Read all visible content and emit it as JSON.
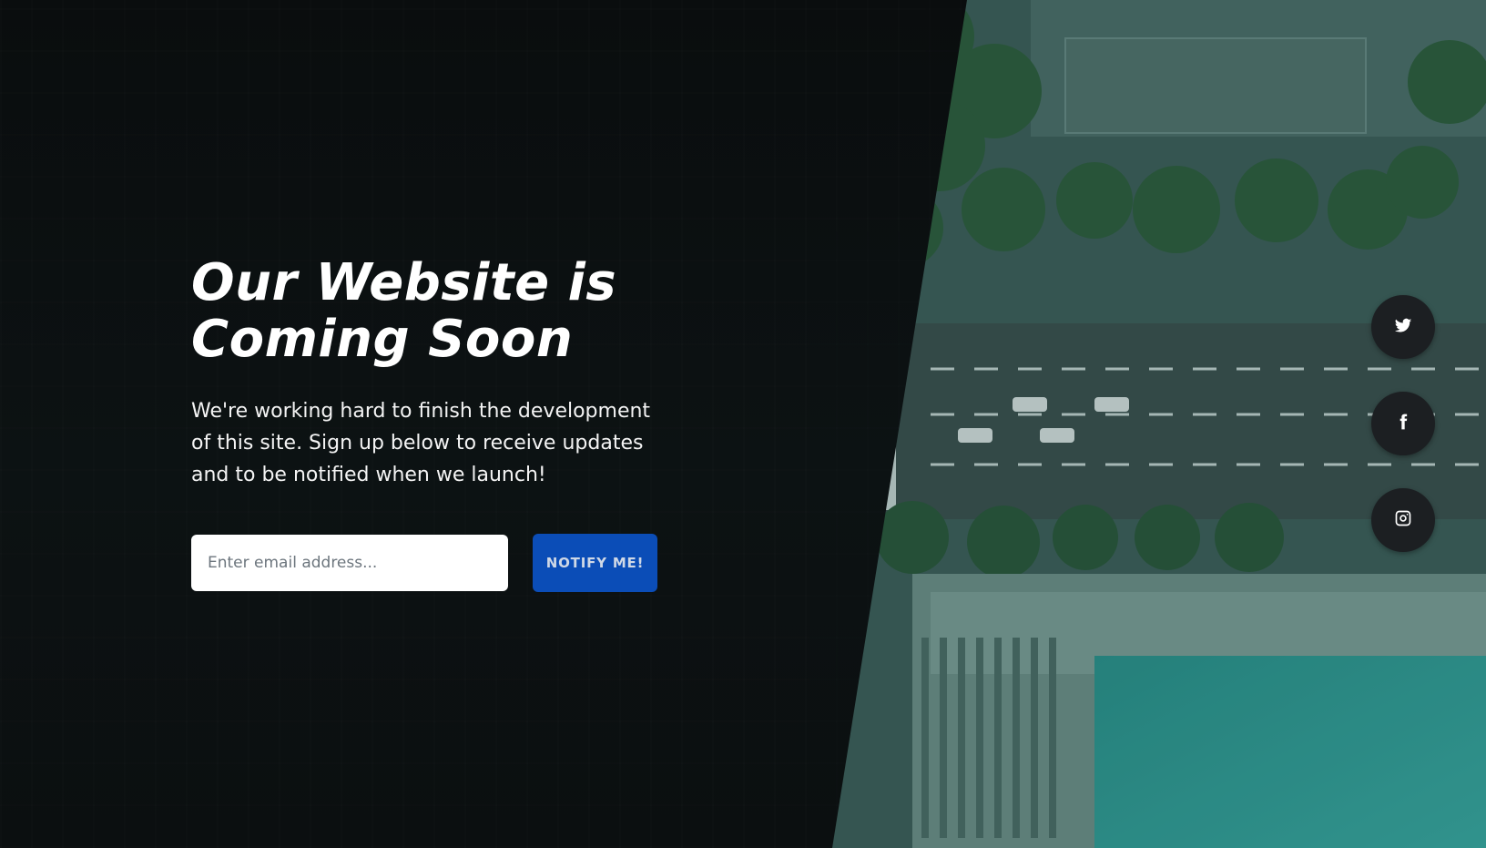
{
  "hero": {
    "title_line1": "Our Website is",
    "title_line2": "Coming Soon",
    "description": "We're working hard to finish the development of this site. Sign up below to receive updates and to be notified when we launch!"
  },
  "form": {
    "email_placeholder": "Enter email address...",
    "submit_label": "NOTIFY ME!"
  },
  "social": {
    "items": [
      {
        "name": "twitter",
        "icon": "twitter-icon"
      },
      {
        "name": "facebook",
        "icon": "facebook-icon"
      },
      {
        "name": "instagram",
        "icon": "instagram-icon"
      }
    ]
  },
  "colors": {
    "primary": "#0b4db7",
    "social_button": "#1c1f22",
    "panel": "#0b0f10"
  }
}
